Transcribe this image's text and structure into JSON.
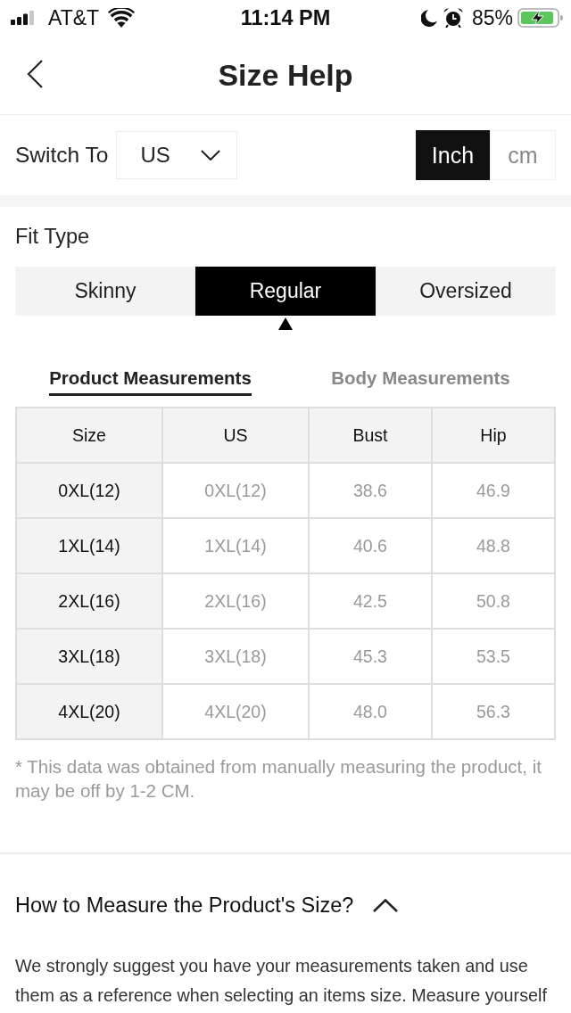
{
  "status_bar": {
    "carrier": "AT&T",
    "time": "11:14 PM",
    "battery": "85%"
  },
  "nav": {
    "title": "Size Help"
  },
  "switch": {
    "label": "Switch To",
    "region": {
      "value": "US"
    },
    "units": [
      {
        "label": "Inch",
        "selected": true
      },
      {
        "label": "cm",
        "selected": false
      }
    ]
  },
  "fit_type": {
    "label": "Fit Type",
    "options": [
      {
        "label": "Skinny",
        "selected": false
      },
      {
        "label": "Regular",
        "selected": true
      },
      {
        "label": "Oversized",
        "selected": false
      }
    ]
  },
  "measure_tabs": [
    {
      "label": "Product Measurements",
      "selected": true
    },
    {
      "label": "Body Measurements",
      "selected": false
    }
  ],
  "table": {
    "columns": [
      "Size",
      "US",
      "Bust",
      "Hip"
    ],
    "rows": [
      [
        "0XL(12)",
        "0XL(12)",
        "38.6",
        "46.9"
      ],
      [
        "1XL(14)",
        "1XL(14)",
        "40.6",
        "48.8"
      ],
      [
        "2XL(16)",
        "2XL(16)",
        "42.5",
        "50.8"
      ],
      [
        "3XL(18)",
        "3XL(18)",
        "45.3",
        "53.5"
      ],
      [
        "4XL(20)",
        "4XL(20)",
        "48.0",
        "56.3"
      ]
    ]
  },
  "note": "* This data was obtained from manually measuring the product, it may be off by 1-2 CM.",
  "how_to": {
    "title": "How to Measure the Product's Size?",
    "expanded": true,
    "text": "We strongly suggest you have your measurements taken and use them as a reference when selecting an items size. Measure yourself"
  }
}
